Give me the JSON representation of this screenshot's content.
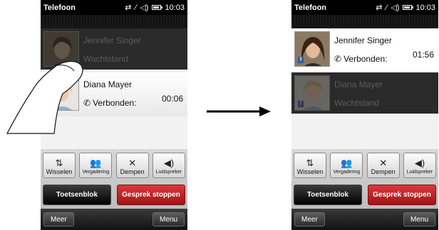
{
  "left_screen": {
    "app_title": "Telefoon",
    "time": "10:03",
    "calls": [
      {
        "name": "Jennifer Singer",
        "status": "Wachtstand",
        "timer": ""
      },
      {
        "name": "Diana Mayer",
        "status": "Verbonden:",
        "timer": "00:06"
      }
    ],
    "buttons": {
      "swap": "Wisselen",
      "conference": "Vergadering",
      "mute": "Dempen",
      "speaker": "Luidspreker"
    },
    "keypad": "Toetsenblok",
    "end_call": "Gesprek stoppen",
    "softkey_left": "Meer",
    "softkey_right": "Menu"
  },
  "right_screen": {
    "app_title": "Telefoon",
    "time": "10:03",
    "calls": [
      {
        "name": "Jennifer Singer",
        "status": "Verbonden:",
        "timer": "01:56"
      },
      {
        "name": "Diana Mayer",
        "status": "Wachtstand",
        "timer": ""
      }
    ],
    "buttons": {
      "swap": "Wisselen",
      "conference": "Vergadering",
      "mute": "Dempen",
      "speaker": "Luidspreker"
    },
    "keypad": "Toetsenblok",
    "end_call": "Gesprek stoppen",
    "softkey_left": "Meer",
    "softkey_right": "Menu"
  },
  "icons": {
    "signal": "signal-icon",
    "data": "data-arrows-icon",
    "volume": "volume-icon",
    "battery": "battery-icon",
    "call_connected": "phone-handset-icon",
    "facebook": "facebook-badge-icon"
  },
  "colors": {
    "end_call": "#c0272a",
    "held_call_bg": "#2a2a2a",
    "active_call_bg": "#ffffff"
  }
}
